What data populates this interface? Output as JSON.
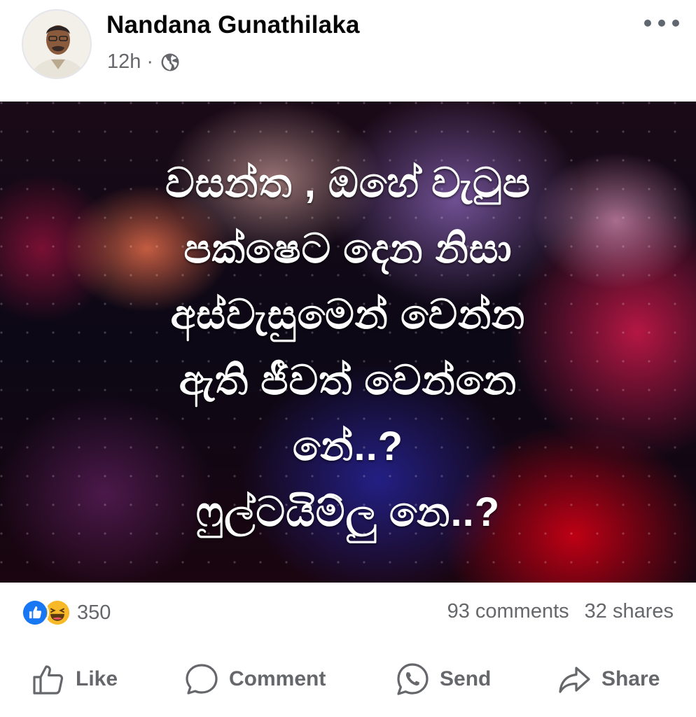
{
  "post": {
    "author": "Nandana Gunathilaka",
    "time": "12h",
    "separator": "·",
    "privacy_icon": "globe-icon",
    "more_icon": "more-options-icon"
  },
  "image_text": {
    "lines": [
      "වසන්ත , ඔහේ වැටුප",
      "පක්ෂෙට දෙන නිසා",
      "අස්වැසුමෙන් වෙන්න",
      "ඇති ජීවත් වෙන්නෙ",
      "නේ..?",
      "ෆුල්ටයිම්ලු නෙ..?"
    ]
  },
  "stats": {
    "reaction_icons": [
      "like-icon",
      "haha-icon"
    ],
    "reaction_count": "350",
    "comments": "93 comments",
    "shares": "32 shares"
  },
  "actions": {
    "like": "Like",
    "comment": "Comment",
    "send": "Send",
    "share": "Share"
  },
  "colors": {
    "secondary_text": "#65676b",
    "like_blue": "#1877f2",
    "haha_yellow": "#f7b928"
  }
}
